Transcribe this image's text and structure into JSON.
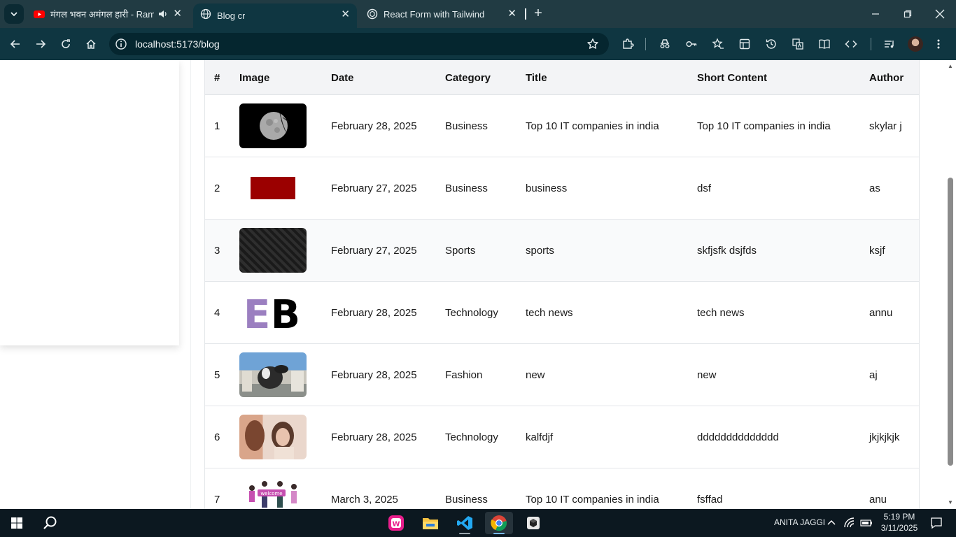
{
  "browser": {
    "tabs": [
      {
        "label": "मंगल भवन अमंगल हारी - Ram",
        "icon": "youtube-icon",
        "audio": true
      },
      {
        "label": "Blog cr",
        "icon": "globe-icon",
        "active": true
      },
      {
        "label": "React Form with Tailwind",
        "icon": "chatgpt-icon"
      }
    ],
    "url": "localhost:5173/blog"
  },
  "table": {
    "headers": [
      "#",
      "Image",
      "Date",
      "Category",
      "Title",
      "Short Content",
      "Author"
    ],
    "rows": [
      {
        "num": "1",
        "image": "moon",
        "date": "February 28, 2025",
        "category": "Business",
        "title": "Top 10 IT companies in india",
        "content": "Top 10 IT companies in india",
        "author": "skylar j"
      },
      {
        "num": "2",
        "image": "red-block",
        "date": "February 27, 2025",
        "category": "Business",
        "title": "business",
        "content": "dsf",
        "author": "as"
      },
      {
        "num": "3",
        "image": "dark-pattern",
        "date": "February 27, 2025",
        "category": "Sports",
        "title": "sports",
        "content": "skfjsfk dsjfds",
        "author": "ksjf"
      },
      {
        "num": "4",
        "image": "eb-logo",
        "date": "February 28, 2025",
        "category": "Technology",
        "title": "tech news",
        "content": "tech news",
        "author": "annu"
      },
      {
        "num": "5",
        "image": "dog-photo",
        "date": "February 28, 2025",
        "category": "Fashion",
        "title": "new",
        "content": "new",
        "author": "aj"
      },
      {
        "num": "6",
        "image": "woman-photo",
        "date": "February 28, 2025",
        "category": "Technology",
        "title": "kalfdjf",
        "content": "dddddddddddddd",
        "author": "jkjkjkjk"
      },
      {
        "num": "7",
        "image": "welcome-illustration",
        "date": "March 3, 2025",
        "category": "Business",
        "title": "Top 10 IT companies in india",
        "content": "fsffad",
        "author": "anu"
      }
    ]
  },
  "thumb_text": {
    "eb": "EB",
    "welcome": "welcome"
  },
  "taskbar": {
    "user": "ANITA JAGGI",
    "time": "5:19 PM",
    "date": "3/11/2025"
  }
}
